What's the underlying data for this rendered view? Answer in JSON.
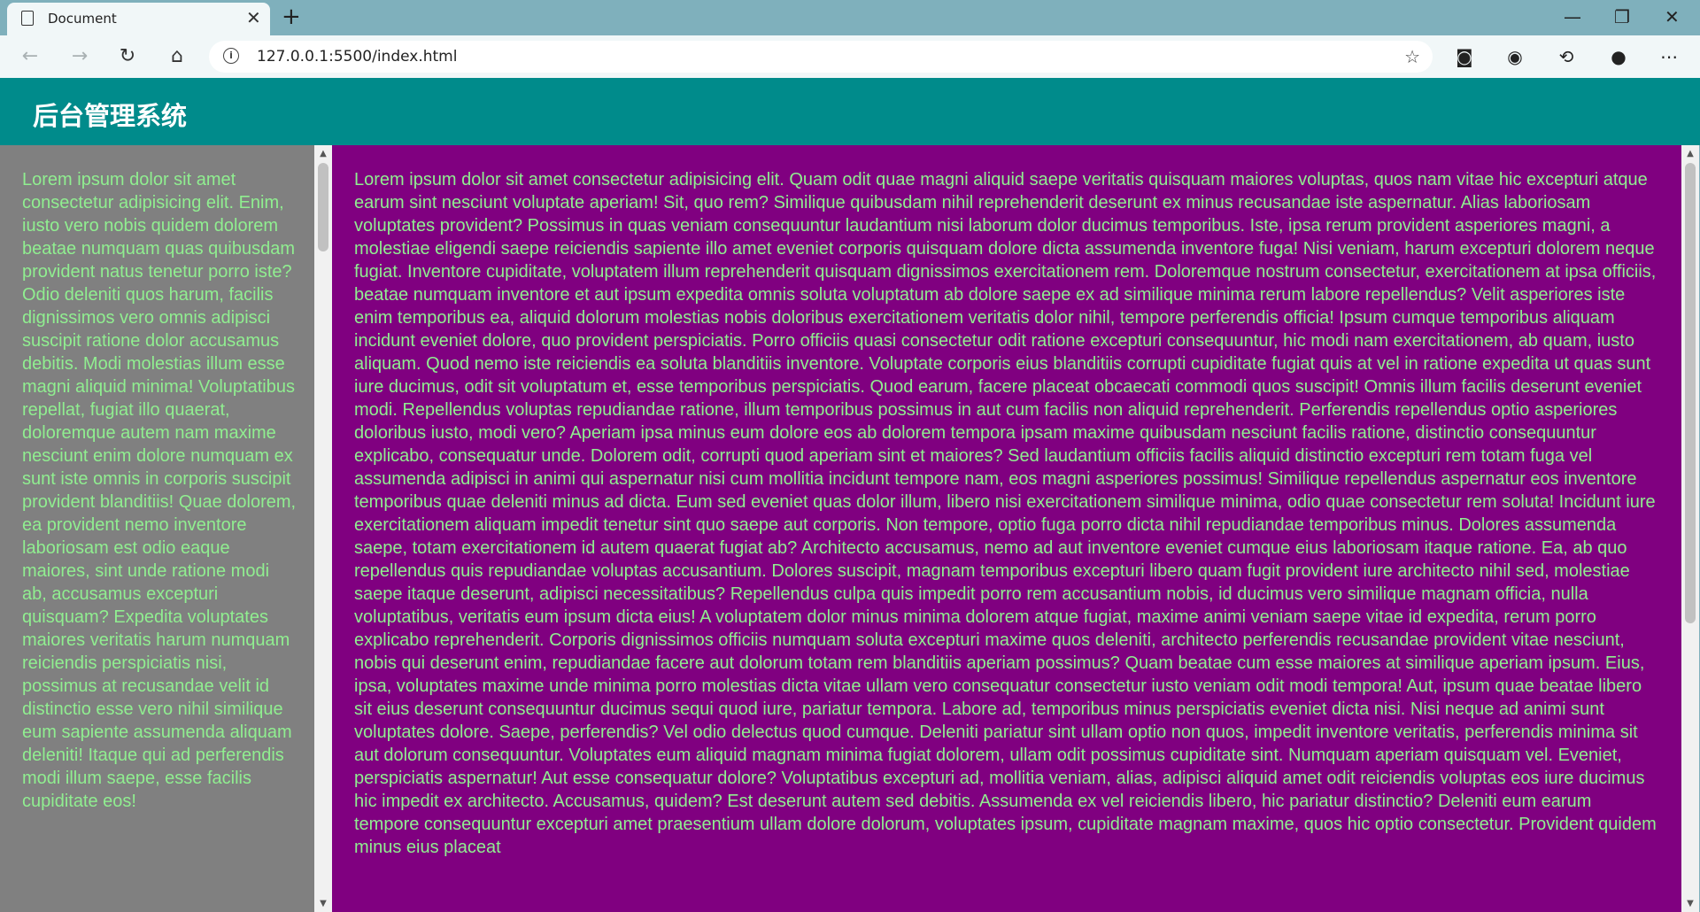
{
  "browser": {
    "tab_title": "Document",
    "url": "127.0.0.1:5500/index.html"
  },
  "app": {
    "title": "后台管理系统"
  },
  "sidebar": {
    "text": "Lorem ipsum dolor sit amet consectetur adipisicing elit. Enim, iusto vero nobis quidem dolorem beatae numquam quas quibusdam provident natus tenetur porro iste? Odio deleniti quos harum, facilis dignissimos vero omnis adipisci suscipit ratione dolor accusamus debitis. Modi molestias illum esse magni aliquid minima! Voluptatibus repellat, fugiat illo quaerat, doloremque autem nam maxime nesciunt enim dolore numquam ex sunt iste omnis in corporis suscipit provident blanditiis! Quae dolorem, ea provident nemo inventore laboriosam est odio eaque maiores, sint unde ratione modi ab, accusamus excepturi quisquam? Expedita voluptates maiores veritatis harum numquam reiciendis perspiciatis nisi, possimus at recusandae velit id distinctio esse vero nihil similique eum sapiente assumenda aliquam deleniti! Itaque qui ad perferendis modi illum saepe, esse facilis cupiditate eos!"
  },
  "main": {
    "text": "Lorem ipsum dolor sit amet consectetur adipisicing elit. Quam odit quae magni aliquid saepe veritatis quisquam maiores voluptas, quos nam vitae hic excepturi atque earum sint nesciunt voluptate aperiam! Sit, quo rem? Similique quibusdam nihil reprehenderit deserunt ex minus recusandae iste aspernatur. Alias laboriosam voluptates provident? Possimus in quas veniam consequuntur laudantium nisi laborum dolor ducimus temporibus. Iste, ipsa rerum provident asperiores magni, a molestiae eligendi saepe reiciendis sapiente illo amet eveniet corporis quisquam dolore dicta assumenda inventore fuga! Nisi veniam, harum excepturi dolorem neque fugiat. Inventore cupiditate, voluptatem illum reprehenderit quisquam dignissimos exercitationem rem. Doloremque nostrum consectetur, exercitationem at ipsa officiis, beatae numquam inventore et aut ipsum expedita omnis soluta voluptatum ab dolore saepe ex ad similique minima rerum labore repellendus? Velit asperiores iste enim temporibus ea, aliquid dolorum molestias nobis doloribus exercitationem veritatis dolor nihil, tempore perferendis officia! Ipsum cumque temporibus aliquam incidunt eveniet dolore, quo provident perspiciatis. Porro officiis quasi consectetur odit ratione excepturi consequuntur, hic modi nam exercitationem, ab quam, iusto aliquam. Quod nemo iste reiciendis ea soluta blanditiis inventore. Voluptate corporis eius blanditiis corrupti cupiditate fugiat quis at vel in ratione expedita ut quas sunt iure ducimus, odit sit voluptatum et, esse temporibus perspiciatis. Quod earum, facere placeat obcaecati commodi quos suscipit! Omnis illum facilis deserunt eveniet modi. Repellendus voluptas repudiandae ratione, illum temporibus possimus in aut cum facilis non aliquid reprehenderit. Perferendis repellendus optio asperiores doloribus iusto, modi vero? Aperiam ipsa minus eum dolore eos ab dolorem tempora ipsam maxime quibusdam nesciunt facilis ratione, distinctio consequuntur explicabo, consequatur unde. Dolorem odit, corrupti quod aperiam sint et maiores? Sed laudantium officiis facilis aliquid distinctio excepturi rem totam fuga vel assumenda adipisci in animi qui aspernatur nisi cum mollitia incidunt tempore nam, eos magni asperiores possimus! Similique repellendus aspernatur eos inventore temporibus quae deleniti minus ad dicta. Eum sed eveniet quas dolor illum, libero nisi exercitationem similique minima, odio quae consectetur rem soluta! Incidunt iure exercitationem aliquam impedit tenetur sint quo saepe aut corporis. Non tempore, optio fuga porro dicta nihil repudiandae temporibus minus. Dolores assumenda saepe, totam exercitationem id autem quaerat fugiat ab? Architecto accusamus, nemo ad aut inventore eveniet cumque eius laboriosam itaque ratione. Ea, ab quo repellendus quis repudiandae voluptas accusantium. Dolores suscipit, magnam temporibus excepturi libero quam fugit provident iure architecto nihil sed, molestiae saepe itaque deserunt, adipisci necessitatibus? Repellendus culpa quis impedit porro rem accusantium nobis, id ducimus vero similique magnam officia, nulla voluptatibus, veritatis eum ipsum dicta eius! A voluptatem dolor minus minima dolorem atque fugiat, maxime animi veniam saepe vitae id expedita, rerum porro explicabo reprehenderit. Corporis dignissimos officiis numquam soluta excepturi maxime quos deleniti, architecto perferendis recusandae provident vitae nesciunt, nobis qui deserunt enim, repudiandae facere aut dolorum totam rem blanditiis aperiam possimus? Quam beatae cum esse maiores at similique aperiam ipsum. Eius, ipsa, voluptates maxime unde minima porro molestias dicta vitae ullam vero consequatur consectetur iusto veniam odit modi tempora! Aut, ipsum quae beatae libero sit eius deserunt consequuntur ducimus sequi quod iure, pariatur tempora. Labore ad, temporibus minus perspiciatis eveniet dicta nisi. Nisi neque ad animi sunt voluptates dolore. Saepe, perferendis? Vel odio delectus quod cumque. Deleniti pariatur sint ullam optio non quos, impedit inventore veritatis, perferendis minima sit aut dolorum consequuntur. Voluptates eum aliquid magnam minima fugiat dolorem, ullam odit possimus cupiditate sint. Numquam aperiam quisquam vel. Eveniet, perspiciatis aspernatur! Aut esse consequatur dolore? Voluptatibus excepturi ad, mollitia veniam, alias, adipisci aliquid amet odit reiciendis voluptas eos iure ducimus hic impedit ex architecto. Accusamus, quidem? Est deserunt autem sed debitis. Assumenda ex vel reiciendis libero, hic pariatur distinctio? Deleniti eum earum tempore consequuntur excepturi amet praesentium ullam dolore dolorum, voluptates ipsum, cupiditate magnam maxime, quos hic optio consectetur. Provident quidem minus eius placeat"
  },
  "colors": {
    "header_bg": "#008b8b",
    "sidebar_bg": "#808080",
    "main_bg": "#800080",
    "text": "#90ee90"
  },
  "icons": {
    "back": "arrow-left",
    "forward": "arrow-right",
    "reload": "reload",
    "home": "home",
    "site_info": "info",
    "favorite": "star-plus",
    "collections": "collections",
    "extension": "extension",
    "history": "history",
    "profile": "profile",
    "more": "ellipsis"
  }
}
